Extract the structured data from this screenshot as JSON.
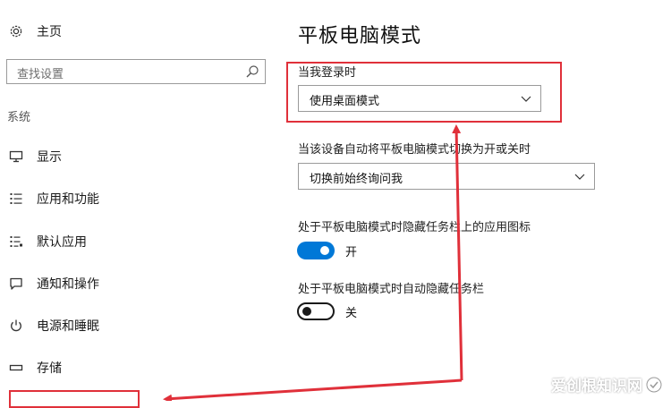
{
  "sidebar": {
    "home_label": "主页",
    "search_placeholder": "查找设置",
    "group_title": "系统",
    "items": [
      {
        "label": "显示",
        "icon": "monitor-icon"
      },
      {
        "label": "应用和功能",
        "icon": "apps-list-icon"
      },
      {
        "label": "默认应用",
        "icon": "default-apps-icon"
      },
      {
        "label": "通知和操作",
        "icon": "notification-icon"
      },
      {
        "label": "电源和睡眠",
        "icon": "power-icon"
      },
      {
        "label": "存储",
        "icon": "storage-icon"
      }
    ]
  },
  "main": {
    "title": "平板电脑模式",
    "signin": {
      "label": "当我登录时",
      "value": "使用桌面模式"
    },
    "switch_prompt": {
      "label": "当该设备自动将平板电脑模式切换为开或关时",
      "value": "切换前始终询问我"
    },
    "hide_icons": {
      "label": "处于平板电脑模式时隐藏任务栏上的应用图标",
      "state_text": "开",
      "on": true
    },
    "auto_hide": {
      "label": "处于平板电脑模式时自动隐藏任务栏",
      "state_text": "关",
      "on": false
    }
  },
  "annotation_color": "#e0303a",
  "accent_color": "#0078d7",
  "watermark": "爱创根知识网"
}
